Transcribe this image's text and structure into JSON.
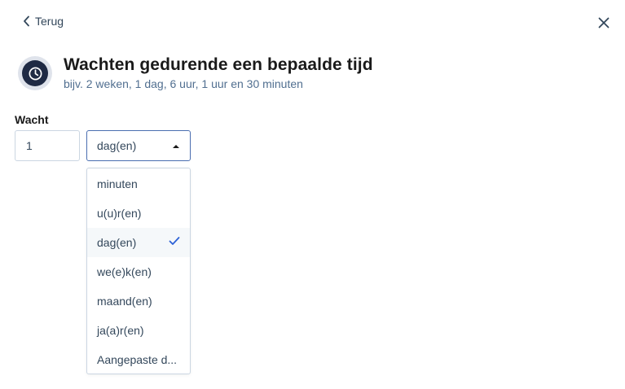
{
  "nav": {
    "back_label": "Terug"
  },
  "header": {
    "title": "Wachten gedurende een bepaalde tijd",
    "subtitle": "bijv. 2 weken, 1 dag, 6 uur, 1 uur en 30 minuten",
    "icon": "clock-icon"
  },
  "form": {
    "wait_label": "Wacht",
    "wait_value": "1",
    "unit_selected": "dag(en)"
  },
  "dropdown": {
    "options": [
      {
        "label": "minuten",
        "selected": false
      },
      {
        "label": "u(u)r(en)",
        "selected": false
      },
      {
        "label": "dag(en)",
        "selected": true
      },
      {
        "label": "we(e)k(en)",
        "selected": false
      },
      {
        "label": "maand(en)",
        "selected": false
      },
      {
        "label": "ja(a)r(en)",
        "selected": false
      },
      {
        "label": "Aangepaste d...",
        "selected": false
      }
    ]
  },
  "colors": {
    "accent": "#4a6eb0",
    "icon_dark": "#1f2a44",
    "icon_ring": "#dfe3eb",
    "check": "#2d62d6"
  }
}
